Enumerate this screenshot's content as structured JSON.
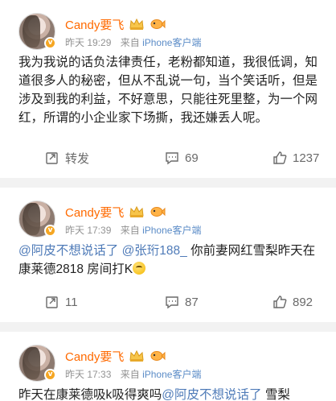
{
  "posts": [
    {
      "author": "Candy要飞",
      "time": "昨天 19:29",
      "source_prefix": "来自",
      "source_client": "iPhone客户端",
      "lines": [
        "我为我说的话负法律责任，老粉都知道，我很低调，知",
        "道很多人的秘密，但从不乱说一句，当个笑话听，但是",
        "涉及到我的利益，不好意思，只能往死里整，为一个网",
        "红，所谓的小企业家下场撕，我还嫌丢人呢。"
      ],
      "repost_label": "转发",
      "comments": "69",
      "likes": "1237"
    },
    {
      "author": "Candy要飞",
      "time": "昨天 17:39",
      "source_prefix": "来自",
      "source_client": "iPhone客户端",
      "mention1": "@阿皮不想说话了",
      "mention2": "@张珩188_",
      "line1_rest": "你前妻网红雪梨昨天在",
      "line2": "康莱德2818 房间打K",
      "reposts": "11",
      "comments": "87",
      "likes": "892"
    },
    {
      "author": "Candy要飞",
      "time": "昨天 17:33",
      "source_prefix": "来自",
      "source_client": "iPhone客户端",
      "line1_pre": "昨天在康莱德吸k吸得爽吗",
      "mention1": "@阿皮不想说话了",
      "line1_post": "雪梨"
    }
  ],
  "colors": {
    "name": "#ff6a00",
    "mention": "#4f7bb8",
    "meta": "#939393",
    "background": "#f2f2f2"
  },
  "icons": [
    "avatar",
    "verified-badge-icon",
    "crown-icon",
    "fish-icon",
    "repost-icon",
    "comment-icon",
    "like-icon",
    "smile-emoji-icon"
  ]
}
